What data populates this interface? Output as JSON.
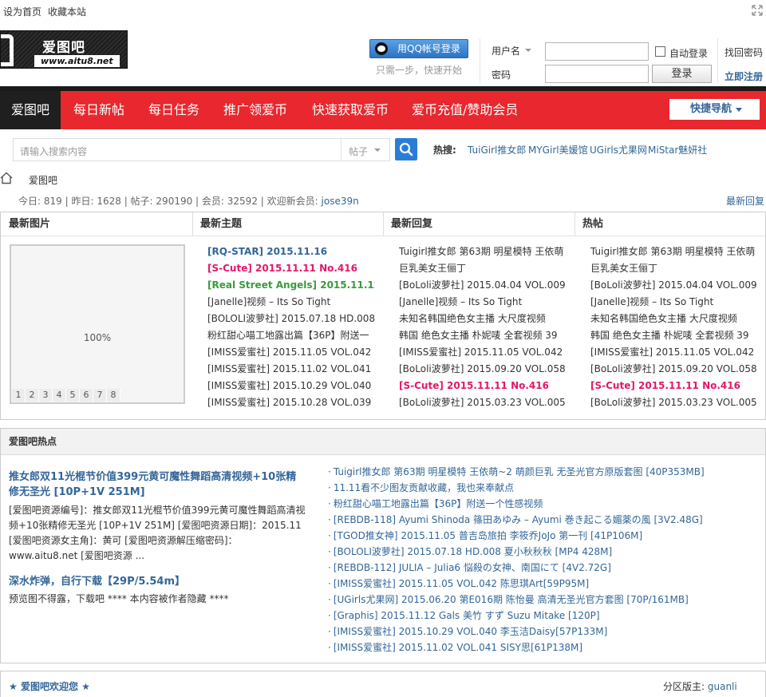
{
  "topbar": {
    "set_home": "设为首页",
    "bookmark": "收藏本站"
  },
  "logo": {
    "name": "爱图吧",
    "url": "www.aitu8.net"
  },
  "login": {
    "qq_button": "用QQ帐号登录",
    "qq_tip": "只需一步，快速开始",
    "username_label": "用户名",
    "password_label": "密码",
    "auto_login": "自动登录",
    "login_button": "登录",
    "find_password": "找回密码",
    "register": "立即注册"
  },
  "nav": {
    "home": "爱图吧",
    "items": [
      "每日新帖",
      "每日任务",
      "推广领爱币",
      "快速获取爱币",
      "爱币充值/赞助会员"
    ],
    "quick_nav": "快捷导航"
  },
  "search": {
    "placeholder": "请输入搜索内容",
    "type": "帖子",
    "hot_label": "热搜:",
    "hot_keywords": [
      "TuiGirl推女郎",
      "MYGirl美媛馆",
      "UGirls尤果网",
      "MiStar魅妍社"
    ]
  },
  "breadcrumb": {
    "current": "爱图吧"
  },
  "stats": {
    "today_label": "今日:",
    "today": "819",
    "yesterday_label": "昨日:",
    "yesterday": "1628",
    "posts_label": "帖子:",
    "posts": "290190",
    "members_label": "会员:",
    "members": "32592",
    "welcome_label": "欢迎新会员:",
    "new_member": "jose39n",
    "latest_reply": "最新回复"
  },
  "grid": {
    "headers": [
      "最新图片",
      "最新主题",
      "最新回复",
      "热帖"
    ],
    "slide_percent": "100%",
    "slide_pages": [
      "1",
      "2",
      "3",
      "4",
      "5",
      "6",
      "7",
      "8"
    ],
    "latest_topics": [
      {
        "text": "[RQ-STAR] 2015.11.16",
        "style": "blue"
      },
      {
        "text": "[S-Cute] 2015.11.11 No.416",
        "style": "pink"
      },
      {
        "text": "[Real Street Angels] 2015.11.12",
        "style": "green"
      },
      {
        "text": "[Janelle]视频 – Its So Tight",
        "style": ""
      },
      {
        "text": "[BOLOLI波萝社] 2015.07.18 HD.008",
        "style": ""
      },
      {
        "text": "粉红甜心喵工地露出篇【36P】附送一",
        "style": ""
      },
      {
        "text": "[IMISS爱蜜社] 2015.11.05 VOL.042",
        "style": ""
      },
      {
        "text": "[IMISS爱蜜社] 2015.11.02 VOL.041",
        "style": ""
      },
      {
        "text": "[IMISS爱蜜社] 2015.10.29 VOL.040",
        "style": ""
      },
      {
        "text": "[IMISS爱蜜社] 2015.10.28 VOL.039",
        "style": ""
      }
    ],
    "latest_replies": [
      {
        "text": "Tuigirl推女郎 第63期 明星模特 王依萌",
        "style": ""
      },
      {
        "text": "巨乳美女王俪丁",
        "style": ""
      },
      {
        "text": "[BoLoli波萝社] 2015.04.04 VOL.009",
        "style": ""
      },
      {
        "text": "[Janelle]视频 – Its So Tight",
        "style": ""
      },
      {
        "text": "未知名韩国绝色女主播 大尺度视频",
        "style": ""
      },
      {
        "text": "韩国 绝色女主播 朴妮唛 全套视频 39",
        "style": ""
      },
      {
        "text": "[IMISS爱蜜社] 2015.11.05 VOL.042",
        "style": ""
      },
      {
        "text": "[BoLoli波萝社] 2015.09.20 VOL.058",
        "style": ""
      },
      {
        "text": "[S-Cute] 2015.11.11 No.416",
        "style": "pink"
      },
      {
        "text": "[BoLoli波萝社] 2015.03.23 VOL.005",
        "style": ""
      }
    ],
    "hot_posts": [
      {
        "text": "Tuigirl推女郎 第63期 明星模特 王依萌",
        "style": ""
      },
      {
        "text": "巨乳美女王俪丁",
        "style": ""
      },
      {
        "text": "[BoLoli波萝社] 2015.04.04 VOL.009",
        "style": ""
      },
      {
        "text": "[Janelle]视频 – Its So Tight",
        "style": ""
      },
      {
        "text": "未知名韩国绝色女主播 大尺度视频",
        "style": ""
      },
      {
        "text": "韩国 绝色女主播 朴妮唛 全套视频 39",
        "style": ""
      },
      {
        "text": "[IMISS爱蜜社] 2015.11.05 VOL.042",
        "style": ""
      },
      {
        "text": "[BoLoli波萝社] 2015.09.20 VOL.058",
        "style": ""
      },
      {
        "text": "[S-Cute] 2015.11.11 No.416",
        "style": "pink"
      },
      {
        "text": "[BoLoli波萝社] 2015.03.23 VOL.005",
        "style": ""
      }
    ]
  },
  "hot": {
    "header": "爱图吧热点",
    "feature_title": "推女郎双11光棍节价值399元黄可魔性舞蹈高清视频+10张精修无圣光 [10P+1V 251M]",
    "feature_desc": "[爱图吧资源编号]：推女郎双11光棍节价值399元黄可魔性舞蹈高清视频+10张精修无圣光 [10P+1V 251M] [爱图吧资源日期]：2015.11 [爱图吧资源女主角]：黄可 [爱图吧资源解压缩密码]：www.aitu8.net [爱图吧资源 ...",
    "second_title": "深水炸弹，自行下载【29P/5.54m】",
    "second_desc": "预览图不得露，下载吧 **** 本内容被作者隐藏 ****",
    "list": [
      "Tuigirl推女郎 第63期 明星模特 王依萌~2 萌颜巨乳 无圣光官方原版套图 [40P353MB]",
      "11.11看不少图友贡献收藏，我也来奉献点",
      "粉红甜心喵工地露出篇【36P】附送一个性感视频",
      "[REBDB-118] Ayumi Shinoda 篠田あゆみ – Ayumi 巻き起こる媚薬の風 [3V2.48G]",
      "[TGOD推女神] 2015.11.05 普吉岛旅拍 李筱乔JoJo 第一刊 [41P106M]",
      "[BOLOLI波萝社] 2015.07.18 HD.008 夏小秋秋秋 [MP4 428M]",
      "[REBDB-112] JULIA – Julia6 悩殺の女神、南国にて [4V2.72G]",
      "[IMISS爱蜜社] 2015.11.05 VOL.042 陈思琪Art[59P95M]",
      "[UGirls尤果网] 2015.06.20 第E016期 陈怡曼 高清无圣光官方套图 [70P/161MB]",
      "[Graphis] 2015.11.12 Gals 美竹 すず Suzu Mitake [120P]",
      "[IMISS爱蜜社] 2015.10.29 VOL.040 李玉洁Daisy[57P133M]",
      "[IMISS爱蜜社] 2015.11.02 VOL.041 SISY思[61P138M]"
    ]
  },
  "welcome": {
    "title": "爱图吧欢迎您",
    "moderator_label": "分区版主:",
    "moderator": "guanli"
  },
  "colors": {
    "nav_red": "#e8282e",
    "link_blue": "#336699",
    "pink": "#e4166b",
    "green": "#3a9b3a"
  }
}
